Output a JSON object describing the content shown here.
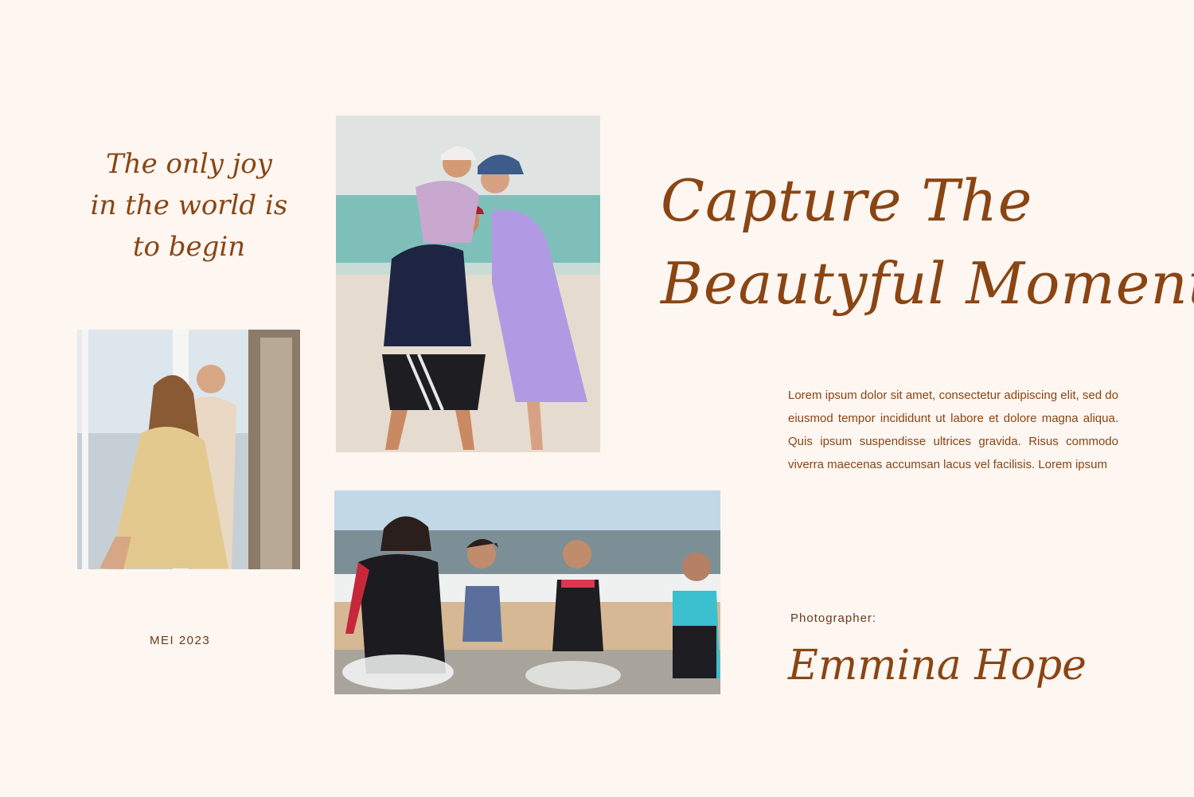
{
  "quote": {
    "lines": [
      "The only joy",
      "in the world is",
      "to begin"
    ]
  },
  "headline": {
    "line1": "Capture The",
    "line2": "Beautyful Moment"
  },
  "body_text": "Lorem ipsum dolor sit amet, consectetur adipiscing elit, sed do eiusmod tempor incididunt ut labore et dolore magna aliqua. Quis ipsum suspendisse ultrices gravida. Risus commodo viverra maecenas accumsan lacus vel facilisis. Lorem ipsum",
  "date": "MEI 2023",
  "photographer": {
    "label": "Photographer:",
    "name": "Emmina Hope"
  },
  "colors": {
    "background": "#fdf6f1",
    "accent": "#8a4513"
  }
}
